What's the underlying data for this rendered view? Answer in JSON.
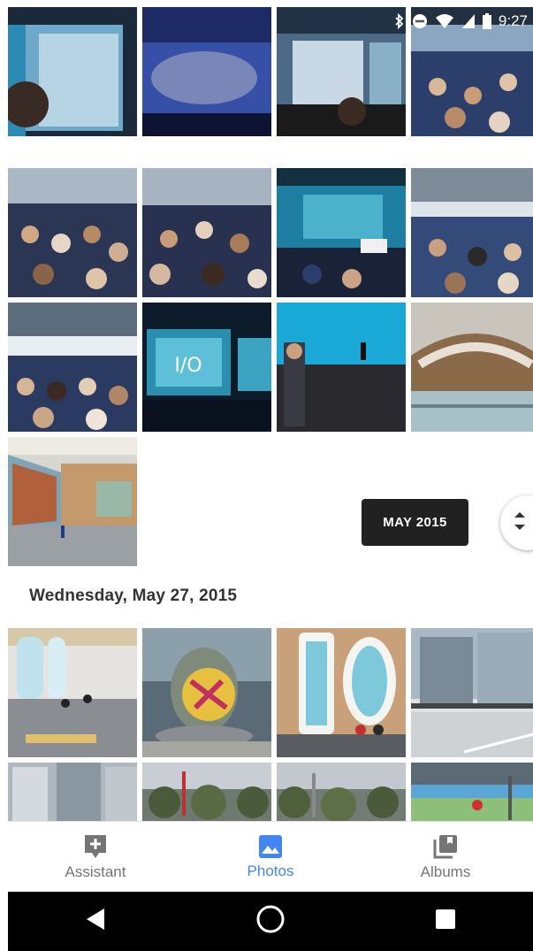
{
  "status_bar": {
    "time": "9:27",
    "icons": [
      "bluetooth-icon",
      "do-not-disturb-icon",
      "wifi-icon",
      "cell-signal-icon",
      "battery-icon"
    ]
  },
  "grid": {
    "section1_count": 13,
    "section2_count": 8
  },
  "scroll": {
    "date_chip": "MAY 2015"
  },
  "section": {
    "date_header": "Wednesday, May 27, 2015"
  },
  "bottom_nav": {
    "items": [
      {
        "label": "Assistant",
        "icon": "assistant-icon",
        "active": false
      },
      {
        "label": "Photos",
        "icon": "photos-icon",
        "active": true
      },
      {
        "label": "Albums",
        "icon": "albums-icon",
        "active": false
      }
    ]
  },
  "system_nav": {
    "buttons": [
      "back-icon",
      "home-icon",
      "recents-icon"
    ]
  },
  "colors": {
    "accent": "#4285f4",
    "inactive": "#757575",
    "chip_bg": "#212121"
  }
}
